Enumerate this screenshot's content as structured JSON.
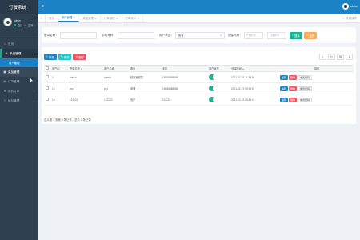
{
  "sidebar": {
    "brand": "订餐系统",
    "profile": {
      "name": "admin",
      "status_label": "在线",
      "logout_label": "注销"
    },
    "nav": [
      {
        "label": "首页",
        "icon": "home-icon",
        "glyph": "⌂"
      },
      {
        "label": "系统管理",
        "icon": "gear-icon",
        "glyph": "⚙",
        "open": true,
        "children": [
          "用户管理"
        ]
      },
      {
        "label": "菜品管理",
        "icon": "dish-icon",
        "glyph": "▦"
      },
      {
        "label": "订单管理",
        "icon": "order-icon",
        "glyph": "▤"
      },
      {
        "label": "我的订单",
        "icon": "list-icon",
        "glyph": "≡"
      },
      {
        "label": "地址管理",
        "icon": "map-icon",
        "glyph": "⚐"
      }
    ]
  },
  "topbar": {
    "username": "admin"
  },
  "tabs": {
    "items": [
      {
        "label": "首页",
        "home": true
      },
      {
        "label": "用户管理",
        "active": true
      },
      {
        "label": "菜品管理"
      },
      {
        "label": "订单管理"
      },
      {
        "label": "订单评价"
      }
    ],
    "right_label": "关闭操作"
  },
  "search": {
    "login_name_label": "登录名称：",
    "phone_label": "手机号码：",
    "status_label": "用户状态：",
    "status_value": "所有",
    "created_label": "创建时间：",
    "start_placeholder": "开始时间",
    "end_placeholder": "结束时间",
    "search_btn": "搜索",
    "reset_btn": "重置"
  },
  "toolbar": {
    "add": "新增",
    "edit": "修改",
    "delete": "删除"
  },
  "table": {
    "headers": [
      "用户ID",
      "登录名称",
      "用户名称",
      "角色",
      "手机",
      "用户状态",
      "创建时间",
      "操作"
    ],
    "rows": [
      {
        "id": "1",
        "login": "admin",
        "name": "admin",
        "role": "超级管理员",
        "phone": "15888888888",
        "created": "2021-02-19 11:33:56"
      },
      {
        "id": "15",
        "login": "ycy",
        "name": "ycy",
        "role": "普通",
        "phone": "15888888888",
        "created": "2021-02-19 09:36:51"
      },
      {
        "id": "16",
        "login": "121123",
        "name": "121123",
        "role": "用户",
        "phone": "121123",
        "created": "2021-02-19 09:46:21"
      }
    ],
    "row_actions": {
      "edit": "编辑",
      "delete": "删除",
      "reset": "重置密码"
    }
  },
  "pager": "显示第 1 到第 3 条记录，总共 3 条记录"
}
